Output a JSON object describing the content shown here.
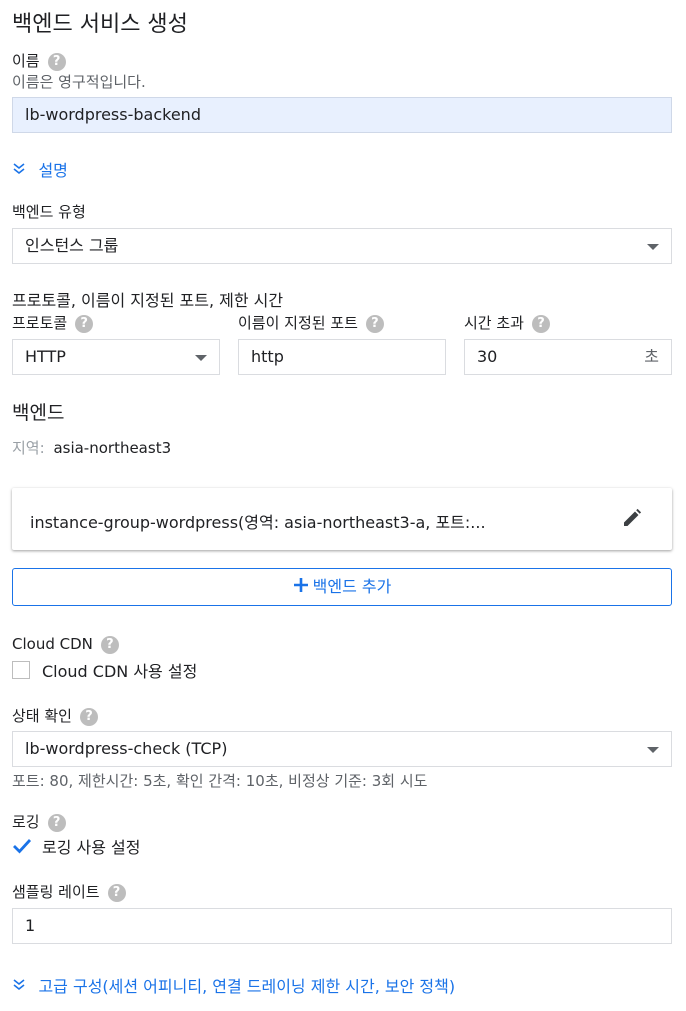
{
  "page": {
    "title": "백엔드 서비스 생성"
  },
  "name": {
    "label": "이름",
    "hint": "이름은 영구적입니다.",
    "value": "lb-wordpress-backend"
  },
  "description_toggle": {
    "label": "설명"
  },
  "backend_type": {
    "label": "백엔드 유형",
    "selected": "인스턴스 그룹"
  },
  "protocol_section": {
    "heading": "프로토콜, 이름이 지정된 포트, 제한 시간",
    "protocol_label": "프로토콜",
    "protocol_value": "HTTP",
    "named_port_label": "이름이 지정된 포트",
    "named_port_value": "http",
    "timeout_label": "시간 초과",
    "timeout_value": "30",
    "timeout_unit": "초"
  },
  "backends": {
    "heading": "백엔드",
    "region_label": "지역:",
    "region_value": "asia-northeast3",
    "item_text": "instance-group-wordpress(영역: asia-northeast3-a, 포트:...",
    "add_label": "백엔드 추가"
  },
  "cdn": {
    "label": "Cloud CDN",
    "checkbox_label": "Cloud CDN 사용 설정",
    "checked": false
  },
  "health_check": {
    "label": "상태 확인",
    "selected": "lb-wordpress-check (TCP)",
    "details": "포트: 80, 제한시간: 5초, 확인 간격: 10초, 비정상 기준: 3회 시도"
  },
  "logging": {
    "label": "로깅",
    "checkbox_label": "로깅 사용 설정",
    "checked": true
  },
  "sampling": {
    "label": "샘플링 레이트",
    "value": "1"
  },
  "advanced": {
    "label": "고급 구성(세션 어피니티, 연결 드레이닝 제한 시간, 보안 정책)"
  },
  "icons": {
    "help": "?",
    "chevron": "chevron-double-down",
    "edit": "pencil",
    "add": "plus",
    "check": "checkmark"
  },
  "colors": {
    "accent": "#1a73e8",
    "filled_field": "#e8f0fe"
  }
}
